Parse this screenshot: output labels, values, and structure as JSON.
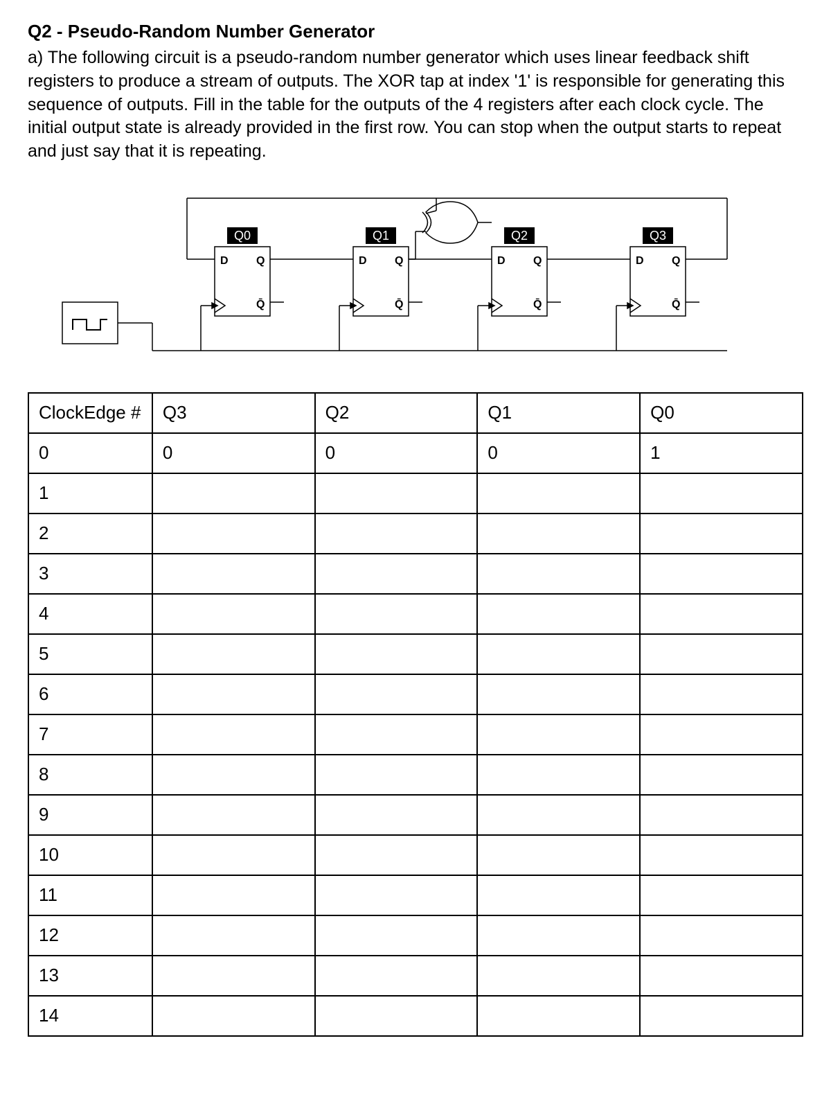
{
  "title": "Q2 - Pseudo-Random Number Generator",
  "prompt": "a) The following circuit is a pseudo-random number generator which uses  linear feedback shift registers to produce a stream of outputs. The XOR tap at index '1' is responsible for generating this sequence of outputs. Fill in the table for the outputs of the 4 registers after each clock cycle. The initial output state is already provided in the first row. You can stop when the output starts to repeat and just say that it is repeating.",
  "circuit": {
    "registers": [
      "Q0",
      "Q1",
      "Q2",
      "Q3"
    ],
    "pin_d": "D",
    "pin_q": "Q",
    "pin_qbar": "Q̄"
  },
  "table": {
    "headers": [
      "ClockEdge #",
      "Q3",
      "Q2",
      "Q1",
      "Q0"
    ],
    "rows": [
      {
        "clk": "0",
        "q3": "0",
        "q2": "0",
        "q1": "0",
        "q0": "1"
      },
      {
        "clk": "1",
        "q3": "",
        "q2": "",
        "q1": "",
        "q0": ""
      },
      {
        "clk": "2",
        "q3": "",
        "q2": "",
        "q1": "",
        "q0": ""
      },
      {
        "clk": "3",
        "q3": "",
        "q2": "",
        "q1": "",
        "q0": ""
      },
      {
        "clk": "4",
        "q3": "",
        "q2": "",
        "q1": "",
        "q0": ""
      },
      {
        "clk": "5",
        "q3": "",
        "q2": "",
        "q1": "",
        "q0": ""
      },
      {
        "clk": "6",
        "q3": "",
        "q2": "",
        "q1": "",
        "q0": ""
      },
      {
        "clk": "7",
        "q3": "",
        "q2": "",
        "q1": "",
        "q0": ""
      },
      {
        "clk": "8",
        "q3": "",
        "q2": "",
        "q1": "",
        "q0": ""
      },
      {
        "clk": "9",
        "q3": "",
        "q2": "",
        "q1": "",
        "q0": ""
      },
      {
        "clk": "10",
        "q3": "",
        "q2": "",
        "q1": "",
        "q0": ""
      },
      {
        "clk": "11",
        "q3": "",
        "q2": "",
        "q1": "",
        "q0": ""
      },
      {
        "clk": "12",
        "q3": "",
        "q2": "",
        "q1": "",
        "q0": ""
      },
      {
        "clk": "13",
        "q3": "",
        "q2": "",
        "q1": "",
        "q0": ""
      },
      {
        "clk": "14",
        "q3": "",
        "q2": "",
        "q1": "",
        "q0": ""
      }
    ]
  }
}
